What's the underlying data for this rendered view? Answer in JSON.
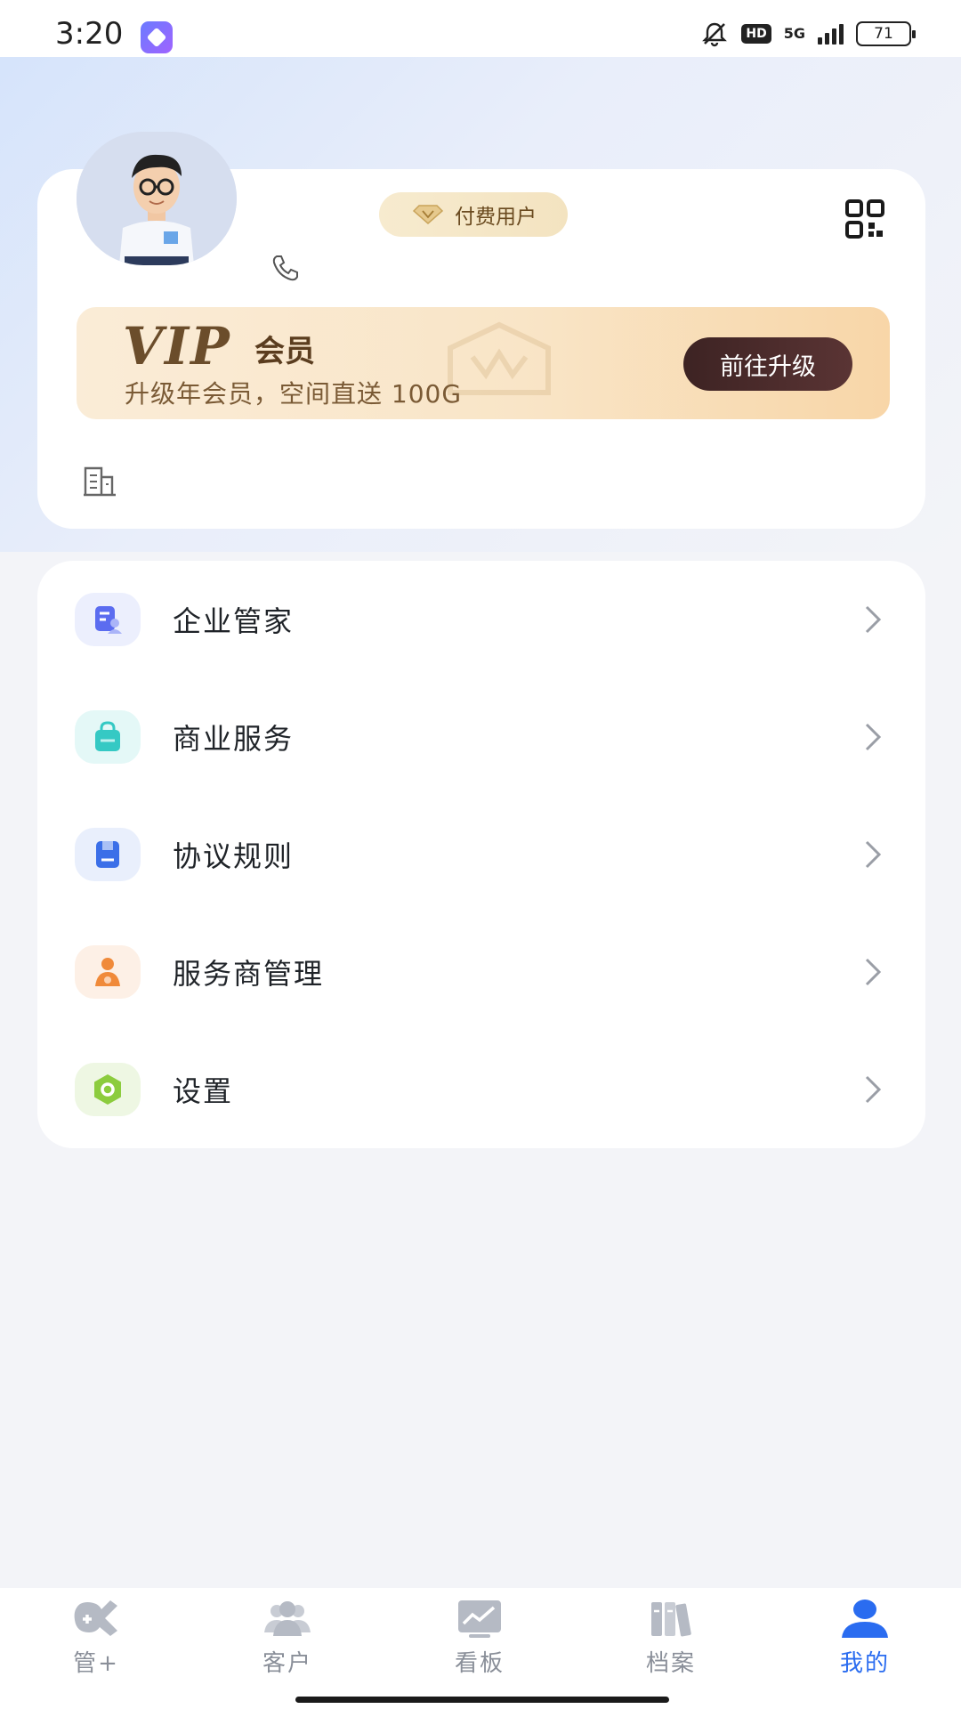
{
  "status_bar": {
    "time": "3:20",
    "network": "5G",
    "hd": "HD",
    "battery": "71",
    "signal_bars": 4
  },
  "profile": {
    "paid_badge": "付费用户",
    "icons": [
      "avatar",
      "phone-icon",
      "qr-code-icon",
      "company-icon"
    ]
  },
  "vip": {
    "logo": "VIP",
    "title": "会员",
    "subtitle": "升级年会员，空间直送 100G",
    "button": "前往升级"
  },
  "menu": {
    "items": [
      {
        "label": "企业管家",
        "icon": "enterprise-steward-icon",
        "color": "#5b6cf0",
        "bg": "#eceffd"
      },
      {
        "label": "商业服务",
        "icon": "shopping-bag-icon",
        "color": "#35c9c4",
        "bg": "#e4f8f7"
      },
      {
        "label": "协议规则",
        "icon": "save-document-icon",
        "color": "#3b6fe8",
        "bg": "#e9effc"
      },
      {
        "label": "服务商管理",
        "icon": "provider-person-icon",
        "color": "#f08a3a",
        "bg": "#fdf0e6"
      },
      {
        "label": "设置",
        "icon": "settings-hexagon-icon",
        "color": "#8ccc3e",
        "bg": "#eef7e3"
      }
    ]
  },
  "bottom_nav": {
    "items": [
      {
        "label": "管+",
        "icon": "guan-plus-icon",
        "active": false
      },
      {
        "label": "客户",
        "icon": "customers-icon",
        "active": false
      },
      {
        "label": "看板",
        "icon": "dashboard-chart-icon",
        "active": false
      },
      {
        "label": "档案",
        "icon": "archive-icon",
        "active": false
      },
      {
        "label": "我的",
        "icon": "profile-person-icon",
        "active": true
      }
    ],
    "inactive_color": "#b5bac4",
    "active_color": "#2a6cf0"
  }
}
